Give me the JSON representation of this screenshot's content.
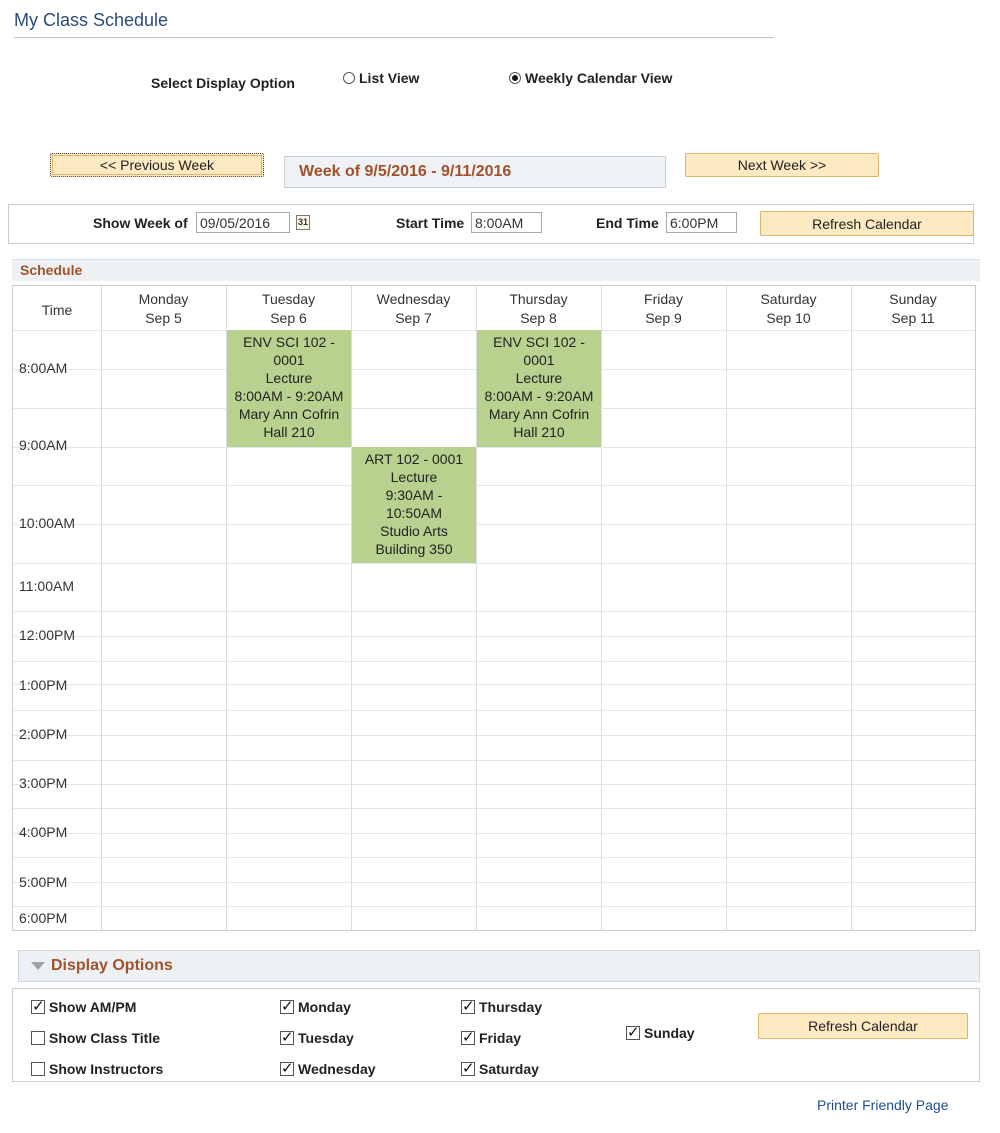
{
  "page": {
    "title": "My Class Schedule"
  },
  "display_option": {
    "label": "Select Display Option",
    "options": [
      {
        "label": "List View",
        "selected": false
      },
      {
        "label": "Weekly Calendar View",
        "selected": true
      }
    ]
  },
  "nav": {
    "prev_label": "<< Previous Week",
    "next_label": "Next Week >>",
    "week_label": "Week of 9/5/2016 - 9/11/2016"
  },
  "toolbar": {
    "show_week_label": "Show Week of",
    "show_week_value": "09/05/2016",
    "calendar_icon": "31",
    "start_label": "Start Time",
    "start_value": "8:00AM",
    "end_label": "End Time",
    "end_value": "6:00PM",
    "refresh_label": "Refresh Calendar"
  },
  "schedule": {
    "header": "Schedule",
    "time_header": "Time",
    "days": [
      {
        "name": "Monday",
        "date": "Sep 5"
      },
      {
        "name": "Tuesday",
        "date": "Sep 6"
      },
      {
        "name": "Wednesday",
        "date": "Sep 7"
      },
      {
        "name": "Thursday",
        "date": "Sep 8"
      },
      {
        "name": "Friday",
        "date": "Sep 9"
      },
      {
        "name": "Saturday",
        "date": "Sep 10"
      },
      {
        "name": "Sunday",
        "date": "Sep 11"
      }
    ],
    "times": [
      "8:00AM",
      "9:00AM",
      "10:00AM",
      "11:00AM",
      "12:00PM",
      "1:00PM",
      "2:00PM",
      "3:00PM",
      "4:00PM",
      "5:00PM",
      "6:00PM"
    ],
    "events": [
      {
        "day": "Tuesday",
        "lines": [
          "ENV SCI 102 -",
          "0001",
          "Lecture",
          "8:00AM - 9:20AM",
          "Mary Ann Cofrin",
          "Hall 210"
        ]
      },
      {
        "day": "Wednesday",
        "lines": [
          "ART 102 - 0001",
          "Lecture",
          "9:30AM -",
          "10:50AM",
          "Studio Arts",
          "Building 350"
        ]
      },
      {
        "day": "Thursday",
        "lines": [
          "ENV SCI 102 -",
          "0001",
          "Lecture",
          "8:00AM - 9:20AM",
          "Mary Ann Cofrin",
          "Hall 210"
        ]
      }
    ],
    "event_color": "#b8d18e"
  },
  "display_options": {
    "header": "Display Options",
    "checkboxes": [
      {
        "label": "Show AM/PM",
        "checked": true
      },
      {
        "label": "Show Class Title",
        "checked": false
      },
      {
        "label": "Show Instructors",
        "checked": false
      },
      {
        "label": "Monday",
        "checked": true
      },
      {
        "label": "Tuesday",
        "checked": true
      },
      {
        "label": "Wednesday",
        "checked": true
      },
      {
        "label": "Thursday",
        "checked": true
      },
      {
        "label": "Friday",
        "checked": true
      },
      {
        "label": "Saturday",
        "checked": true
      },
      {
        "label": "Sunday",
        "checked": true
      }
    ],
    "refresh_label": "Refresh Calendar"
  },
  "footer": {
    "printer_link": "Printer Friendly Page"
  },
  "colors": {
    "accent": "#a0522d",
    "title": "#2e4a7a",
    "button_bg": "#fde9c2",
    "link": "#1f4f8f"
  }
}
